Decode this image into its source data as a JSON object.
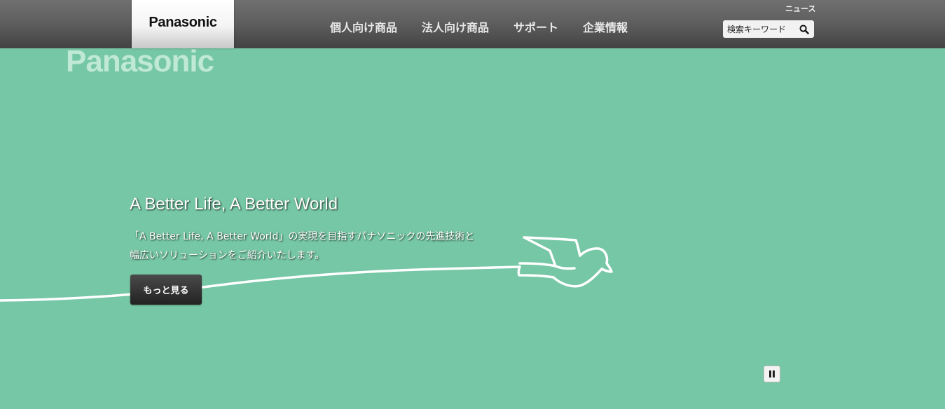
{
  "header": {
    "logo_text": "Panasonic",
    "nav_items": [
      {
        "label": "個人向け商品"
      },
      {
        "label": "法人向け商品"
      },
      {
        "label": "サポート"
      },
      {
        "label": "企業情報"
      }
    ],
    "news_link": "ニュース",
    "search": {
      "placeholder": "検索キーワード",
      "icon": "search-icon"
    }
  },
  "hero": {
    "brand_watermark": "Panasonic",
    "title": "A Better Life, A Better World",
    "description_lines": [
      "「A Better Life, A Better World」の実現を目指すパナソニックの先進技術と",
      "幅広いソリューションをご紹介いたします。"
    ],
    "more_button_label": "もっと見る",
    "pause_icon": "pause-icon",
    "background_color": "#76c7a5",
    "line_art": "white line drawing of a bird at the end of a long line"
  }
}
